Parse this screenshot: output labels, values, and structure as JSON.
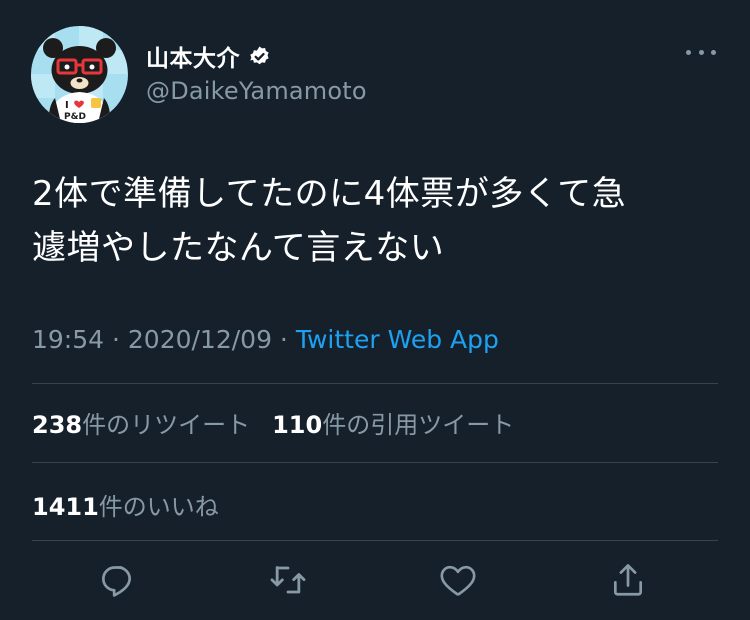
{
  "author": {
    "display_name": "山本大介",
    "handle": "@DaikeYamamoto",
    "verified": true,
    "avatar_shirt_text": "P&D"
  },
  "tweet": {
    "text_line1": "2体で準備してたのに4体票が多くて急",
    "text_line2": "遽増やしたなんて言えない"
  },
  "meta": {
    "time": "19:54",
    "separator": " · ",
    "date": "2020/12/09",
    "source": "Twitter Web App"
  },
  "stats": {
    "retweets": "238",
    "retweets_label": "件のリツイート",
    "quotes": "110",
    "quotes_label": "件の引用ツイート",
    "likes": "1411",
    "likes_label": "件のいいね"
  },
  "actions": [
    {
      "icon": "reply-icon"
    },
    {
      "icon": "retweet-icon"
    },
    {
      "icon": "like-icon"
    },
    {
      "icon": "share-icon"
    }
  ],
  "colors": {
    "background": "#15202b",
    "accent": "#1da1f2",
    "muted": "#8899a6",
    "divider": "#38444d"
  }
}
